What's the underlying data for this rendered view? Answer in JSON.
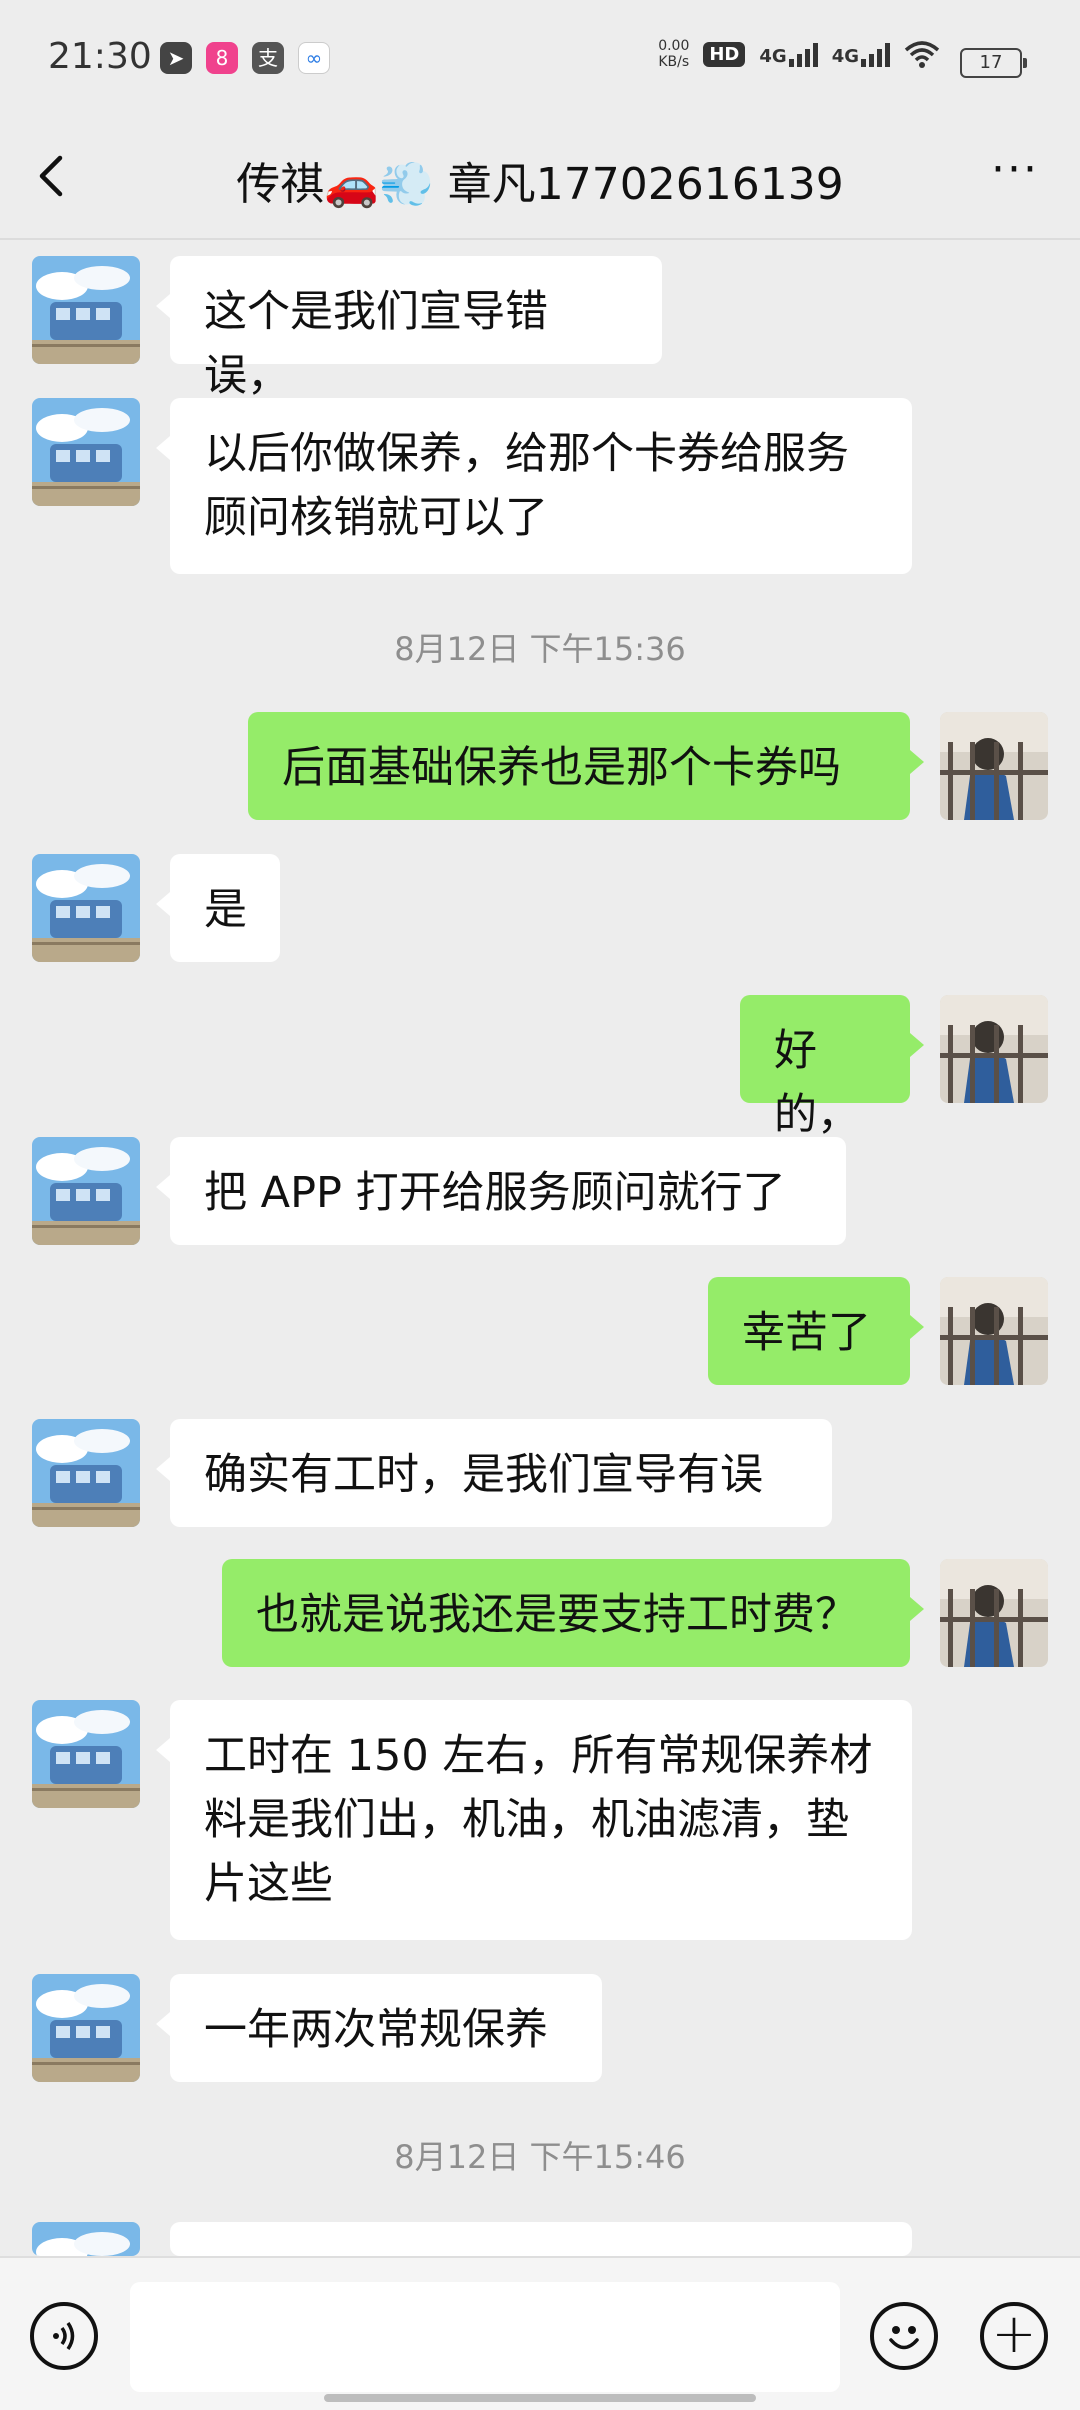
{
  "status_bar": {
    "time": "21:30",
    "net_speed_value": "0.00",
    "net_speed_unit": "KB/s",
    "hd_badge": "HD",
    "signal_1": "4G",
    "signal_2": "4G",
    "battery": "17"
  },
  "header": {
    "title": "传祺🚗💨 章凡17702616139",
    "back_icon": "chevron-left-icon",
    "more_icon": "more-dots-icon",
    "more_label": "···"
  },
  "timestamps": [
    "8月12日 下午15:36",
    "8月12日 下午15:46"
  ],
  "messages": [
    {
      "side": "in",
      "text": "这个是我们宣导错误，"
    },
    {
      "side": "in",
      "text": "以后你做保养，给那个卡券给服务顾问核销就可以了"
    },
    {
      "side": "out",
      "text": "后面基础保养也是那个卡券吗"
    },
    {
      "side": "in",
      "text": "是"
    },
    {
      "side": "out",
      "text": "好的，"
    },
    {
      "side": "in",
      "text": "把 APP 打开给服务顾问就行了"
    },
    {
      "side": "out",
      "text": "幸苦了"
    },
    {
      "side": "in",
      "text": "确实有工时，是我们宣导有误"
    },
    {
      "side": "out",
      "text": "也就是说我还是要支持工时费？"
    },
    {
      "side": "in",
      "text": "工时在 150 左右，所有常规保养材料是我们出，机油，机油滤清，垫片这些"
    },
    {
      "side": "in",
      "text": "一年两次常规保养"
    }
  ],
  "input_bar": {
    "voice_icon": "voice-input-icon",
    "emoji_icon": "emoji-icon",
    "plus_icon": "plus-icon",
    "emoji_glyph": "☺",
    "plus_glyph": "+",
    "voice_glyph": "◂)"
  },
  "colors": {
    "background": "#ededed",
    "bubble_in": "#ffffff",
    "bubble_out": "#95ec69",
    "timestamp": "#8e8e8e"
  }
}
